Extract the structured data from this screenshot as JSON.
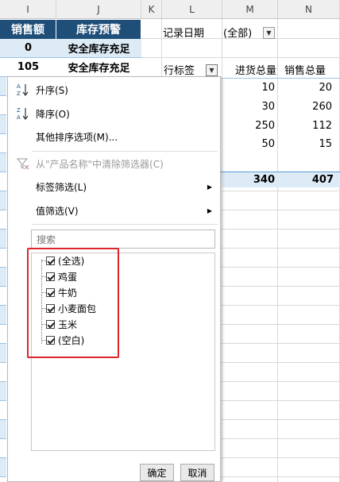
{
  "columns": {
    "i": "I",
    "j": "J",
    "k": "K",
    "l": "L",
    "m": "M",
    "n": "N"
  },
  "table": {
    "headers": [
      "销售额",
      "库存预警"
    ],
    "rows": [
      {
        "sales": "0",
        "warning": "安全库存充足"
      },
      {
        "sales": "105",
        "warning": "安全库存充足"
      }
    ]
  },
  "pivot": {
    "filter_label": "记录日期",
    "filter_value": "(全部)",
    "row_label": "行标签",
    "col1": "进货总量",
    "col2": "销售总量",
    "rows": [
      {
        "in": "10",
        "out": "20"
      },
      {
        "in": "30",
        "out": "260"
      },
      {
        "in": "250",
        "out": "112"
      },
      {
        "in": "50",
        "out": "15"
      }
    ],
    "total_in": "340",
    "total_out": "407"
  },
  "menu": {
    "sort_asc": "升序(S)",
    "sort_desc": "降序(O)",
    "more_sort": "其他排序选项(M)...",
    "clear_filter": "从\"产品名称\"中清除筛选器(C)",
    "label_filter": "标签筛选(L)",
    "value_filter": "值筛选(V)",
    "search_placeholder": "搜索",
    "items": [
      "(全选)",
      "鸡蛋",
      "牛奶",
      "小麦面包",
      "玉米",
      "(空白)"
    ],
    "ok": "确定",
    "cancel": "取消"
  },
  "colors": {
    "header_blue": "#1f4e79",
    "light_blue": "#ddebf7",
    "highlight_red": "#e0242d"
  }
}
